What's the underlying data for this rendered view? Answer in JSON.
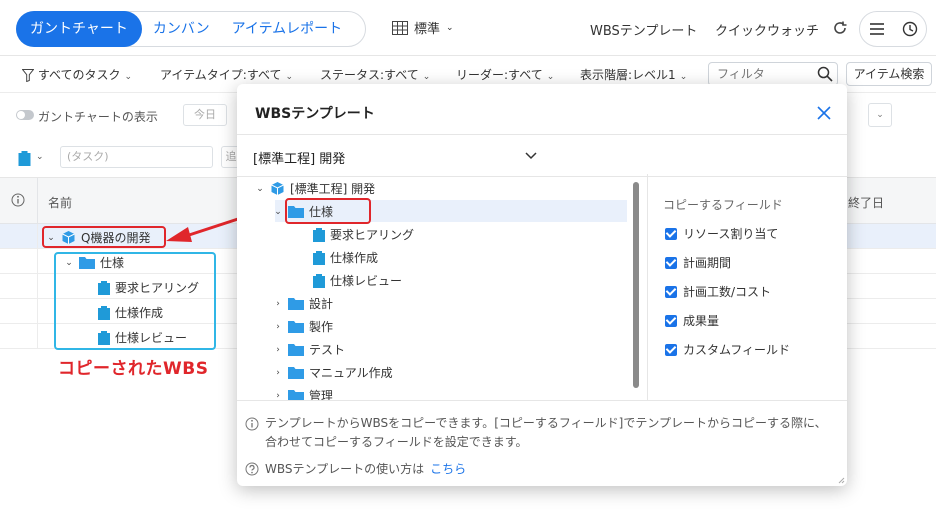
{
  "topbar": {
    "tabs": [
      {
        "label": "ガントチャート",
        "active": true
      },
      {
        "label": "カンバン",
        "active": false
      },
      {
        "label": "アイテムレポート",
        "active": false
      }
    ],
    "layout_label": "標準",
    "wbs_template_label": "WBSテンプレート",
    "quick_watch_label": "クイックウォッチ"
  },
  "filters": {
    "all_tasks": "すべてのタスク",
    "item_type": "アイテムタイプ:すべて",
    "status": "ステータス:すべて",
    "leader": "リーダー:すべて",
    "level": "表示階層:レベル1",
    "search_placeholder": "フィルタ",
    "item_search_label": "アイテム検索"
  },
  "gantt_toolbar": {
    "show_gantt_label": "ガントチャートの表示",
    "today_label": "今日"
  },
  "add_row": {
    "task_placeholder": "(タスク)",
    "extra_placeholder": "追"
  },
  "grid": {
    "col_name": "名前",
    "col_end": "終了日",
    "rows": [
      {
        "label": "Q機器の開発",
        "kind": "package"
      },
      {
        "label": "仕様",
        "kind": "folder"
      },
      {
        "label": "要求ヒアリング",
        "kind": "task"
      },
      {
        "label": "仕様作成",
        "kind": "task"
      },
      {
        "label": "仕様レビュー",
        "kind": "task"
      }
    ]
  },
  "annotation_text": "コピーされたWBS",
  "modal": {
    "title": "WBSテンプレート",
    "selected_template": "[標準工程] 開発",
    "tree": [
      {
        "label": "[標準工程] 開発",
        "kind": "package",
        "expanded": true
      },
      {
        "label": "仕様",
        "kind": "folder",
        "expanded": true
      },
      {
        "label": "要求ヒアリング",
        "kind": "task"
      },
      {
        "label": "仕様作成",
        "kind": "task"
      },
      {
        "label": "仕様レビュー",
        "kind": "task"
      },
      {
        "label": "設計",
        "kind": "folder"
      },
      {
        "label": "製作",
        "kind": "folder"
      },
      {
        "label": "テスト",
        "kind": "folder"
      },
      {
        "label": "マニュアル作成",
        "kind": "folder"
      },
      {
        "label": "管理",
        "kind": "folder"
      }
    ],
    "fields_title": "コピーするフィールド",
    "fields": [
      {
        "label": "リソース割り当て",
        "checked": true
      },
      {
        "label": "計画期間",
        "checked": true
      },
      {
        "label": "計画工数/コスト",
        "checked": true
      },
      {
        "label": "成果量",
        "checked": true
      },
      {
        "label": "カスタムフィールド",
        "checked": true
      }
    ],
    "info_text": "テンプレートからWBSをコピーできます。[コピーするフィールド]でテンプレートからコピーする際に、合わせてコピーするフィールドを設定できます。",
    "help_prefix": "WBSテンプレートの使い方は",
    "help_link": "こちら"
  },
  "colors": {
    "accent": "#1a73e8",
    "folder": "#2f9be6",
    "task_icon": "#1f9ad8",
    "annotation_red": "#e0262b",
    "annotation_blue": "#30b6e6",
    "selected_row": "#e9f0fb"
  }
}
